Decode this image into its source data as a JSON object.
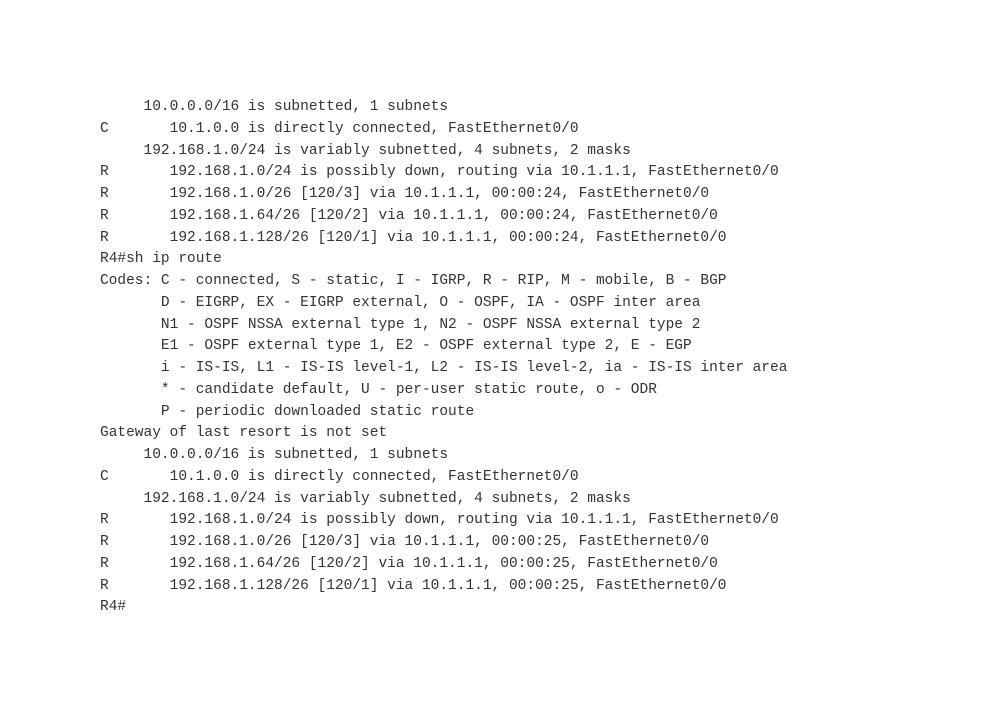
{
  "terminal": {
    "lines": [
      "     10.0.0.0/16 is subnetted, 1 subnets",
      "C       10.1.0.0 is directly connected, FastEthernet0/0",
      "     192.168.1.0/24 is variably subnetted, 4 subnets, 2 masks",
      "R       192.168.1.0/24 is possibly down, routing via 10.1.1.1, FastEthernet0/0",
      "R       192.168.1.0/26 [120/3] via 10.1.1.1, 00:00:24, FastEthernet0/0",
      "R       192.168.1.64/26 [120/2] via 10.1.1.1, 00:00:24, FastEthernet0/0",
      "R       192.168.1.128/26 [120/1] via 10.1.1.1, 00:00:24, FastEthernet0/0",
      "R4#sh ip route",
      "Codes: C - connected, S - static, I - IGRP, R - RIP, M - mobile, B - BGP",
      "       D - EIGRP, EX - EIGRP external, O - OSPF, IA - OSPF inter area",
      "       N1 - OSPF NSSA external type 1, N2 - OSPF NSSA external type 2",
      "       E1 - OSPF external type 1, E2 - OSPF external type 2, E - EGP",
      "       i - IS-IS, L1 - IS-IS level-1, L2 - IS-IS level-2, ia - IS-IS inter area",
      "       * - candidate default, U - per-user static route, o - ODR",
      "       P - periodic downloaded static route",
      "",
      "Gateway of last resort is not set",
      "",
      "     10.0.0.0/16 is subnetted, 1 subnets",
      "C       10.1.0.0 is directly connected, FastEthernet0/0",
      "     192.168.1.0/24 is variably subnetted, 4 subnets, 2 masks",
      "R       192.168.1.0/24 is possibly down, routing via 10.1.1.1, FastEthernet0/0",
      "R       192.168.1.0/26 [120/3] via 10.1.1.1, 00:00:25, FastEthernet0/0",
      "R       192.168.1.64/26 [120/2] via 10.1.1.1, 00:00:25, FastEthernet0/0",
      "R       192.168.1.128/26 [120/1] via 10.1.1.1, 00:00:25, FastEthernet0/0",
      "R4#"
    ]
  }
}
